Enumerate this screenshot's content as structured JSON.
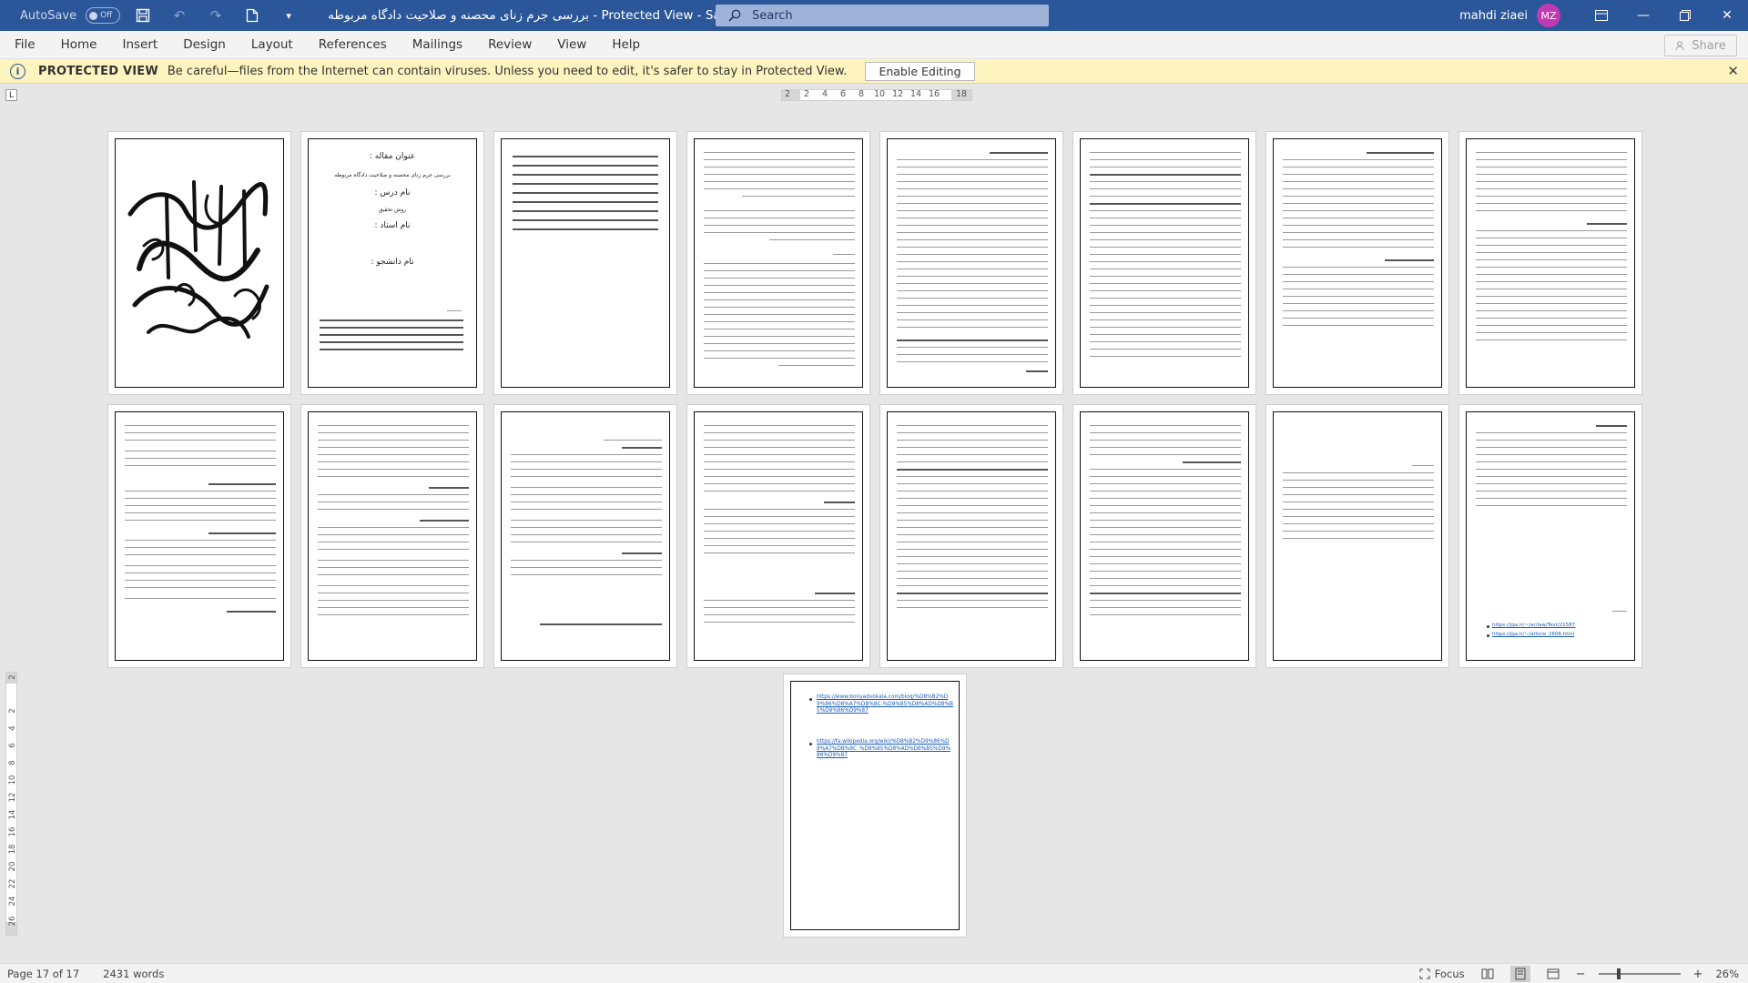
{
  "titlebar": {
    "autosave_label": "AutoSave",
    "autosave_state": "Off",
    "document_title": "بررسی جرم زنای محصنه و صلاحیت دادگاه مربوطه  -  Protected View  -  Saved to this PC",
    "search_placeholder": "Search",
    "user_name": "mahdi ziaei",
    "user_initials": "MZ"
  },
  "menu": {
    "items": [
      "File",
      "Home",
      "Insert",
      "Design",
      "Layout",
      "References",
      "Mailings",
      "Review",
      "View",
      "Help"
    ],
    "share_label": "Share"
  },
  "protected_view": {
    "title": "PROTECTED VIEW",
    "message": "Be careful—files from the Internet can contain viruses. Unless you need to edit, it's safer to stay in Protected View.",
    "enable_button": "Enable Editing"
  },
  "ruler": {
    "corner": "L",
    "h_ticks": [
      "2",
      "2",
      "4",
      "6",
      "8",
      "10",
      "12",
      "14",
      "16",
      "18"
    ],
    "v_ticks": [
      "2",
      "2",
      "4",
      "6",
      "8",
      "10",
      "12",
      "14",
      "16",
      "18",
      "20",
      "22",
      "24",
      "26"
    ]
  },
  "pages": {
    "cover": {
      "line1": "عنوان مقاله :",
      "line2": "بررسی جرم زنای محصنه و صلاحیت دادگاه مربوطه",
      "line3": "نام درس :",
      "line4": "روش تحقیق",
      "line5": "نام استاد :",
      "line6": "نام دانشجو :"
    },
    "links": {
      "link1": "https://www.bonyadvokala.com/blog/%D8%B2%D9%86%D8%A7%DB%8C-%D9%85%D8%AD%D8%B5%D9%86%D9%87",
      "link2": "https://fa.wikipedia.org/wiki/%D8%B2%D9%86%D8%A7%DB%8C_%D9%85%D8%AD%D8%B5%D9%86%D9%87"
    },
    "refs": [
      "https://jqa.ir/~/ar/law/Text/21587",
      "https://jqa.ir/~/article_2606.html"
    ]
  },
  "statusbar": {
    "page_info": "Page 17 of 17",
    "words": "2431 words",
    "focus": "Focus",
    "zoom": "26%"
  }
}
